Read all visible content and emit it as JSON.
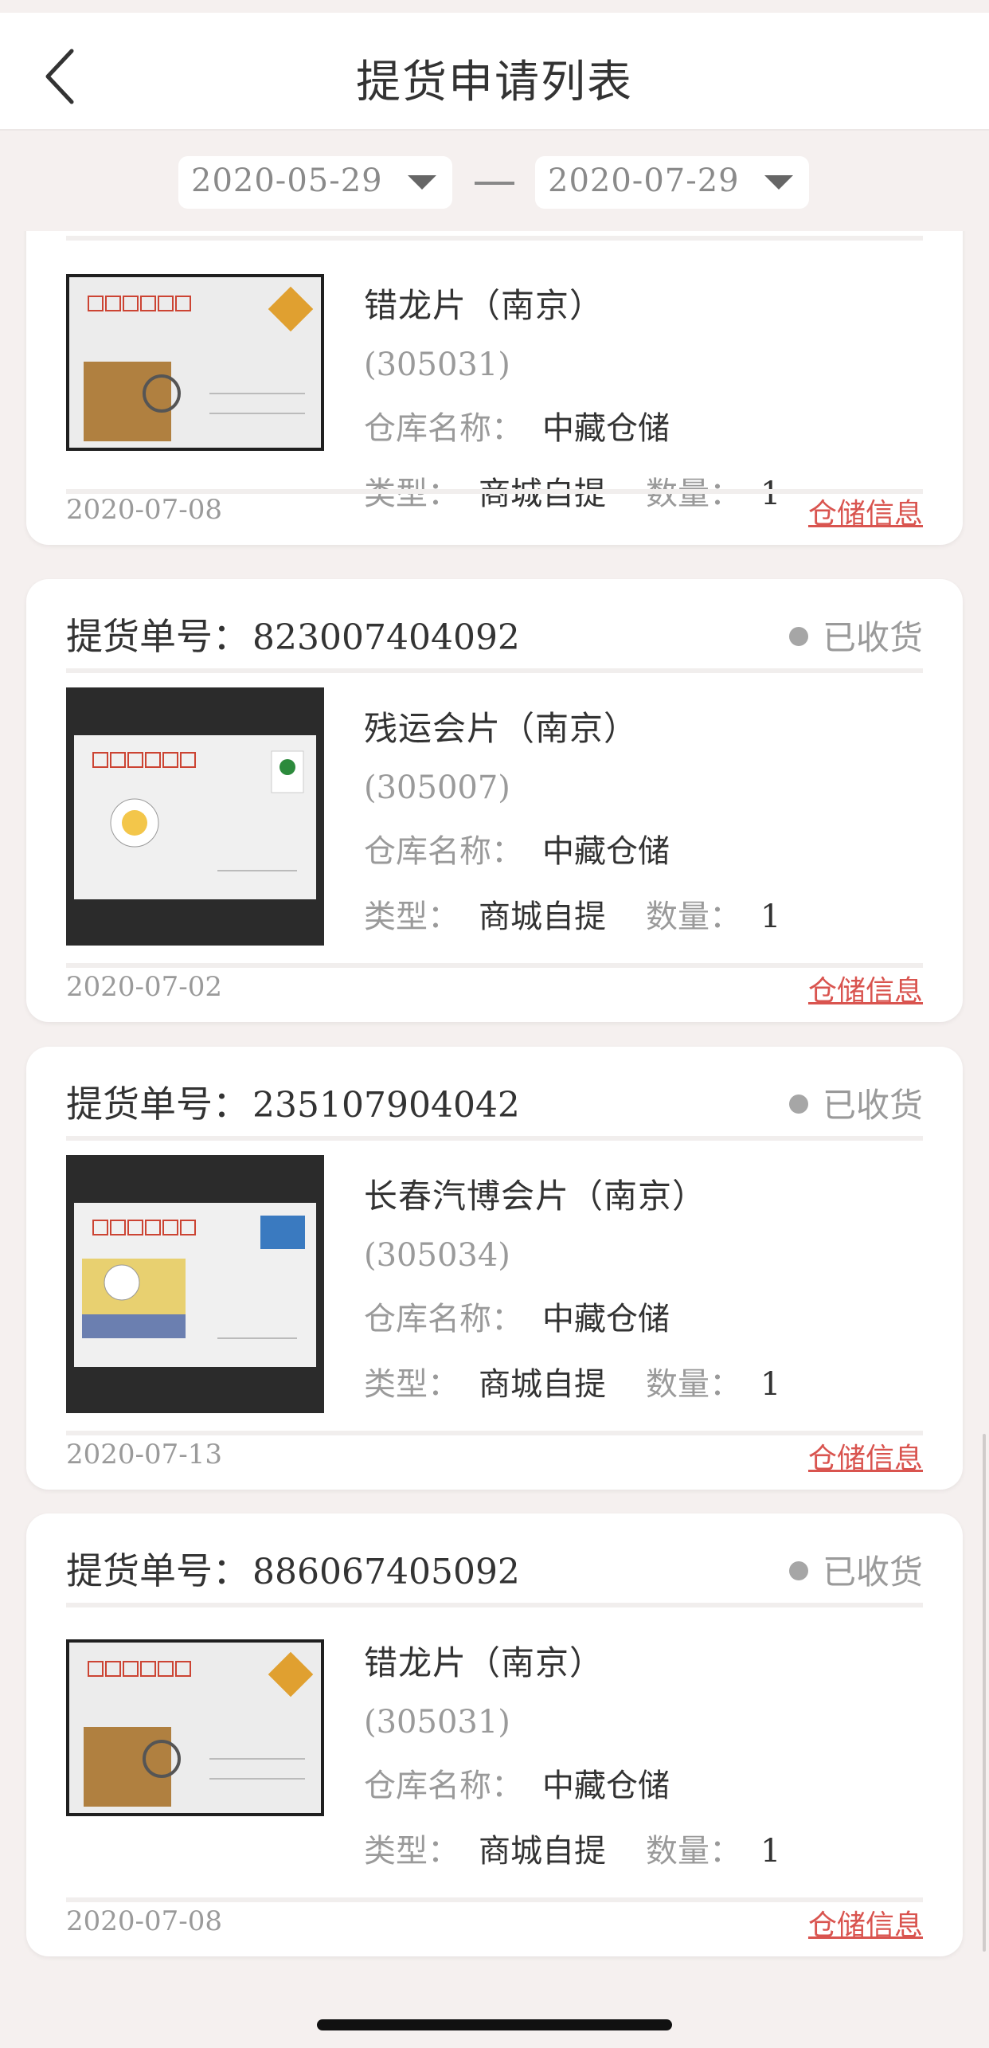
{
  "header": {
    "title": "提货申请列表",
    "back_icon": "chevron-left-icon"
  },
  "filter": {
    "start_date": "2020-05-29",
    "end_date": "2020-07-29",
    "separator": "—"
  },
  "labels": {
    "order_no": "提货单号：",
    "warehouse": "仓库名称：",
    "type": "类型：",
    "quantity": "数量：",
    "storage_link": "仓储信息"
  },
  "orders": [
    {
      "order_no": "",
      "status": "",
      "product_name": "错龙片（南京）",
      "product_code": "(305031)",
      "warehouse": "中藏仓储",
      "type": "商城自提",
      "quantity": "1",
      "date": "2020-07-08"
    },
    {
      "order_no": "823007404092",
      "status": "已收货",
      "product_name": "残运会片（南京）",
      "product_code": "(305007)",
      "warehouse": "中藏仓储",
      "type": "商城自提",
      "quantity": "1",
      "date": "2020-07-02"
    },
    {
      "order_no": "235107904042",
      "status": "已收货",
      "product_name": "长春汽博会片（南京）",
      "product_code": "(305034)",
      "warehouse": "中藏仓储",
      "type": "商城自提",
      "quantity": "1",
      "date": "2020-07-13"
    },
    {
      "order_no": "886067405092",
      "status": "已收货",
      "product_name": "错龙片（南京）",
      "product_code": "(305031)",
      "warehouse": "中藏仓储",
      "type": "商城自提",
      "quantity": "1",
      "date": "2020-07-08"
    }
  ],
  "colors": {
    "accent": "#d9544f",
    "background": "#f5f0ef",
    "muted": "#9a9a9a"
  }
}
